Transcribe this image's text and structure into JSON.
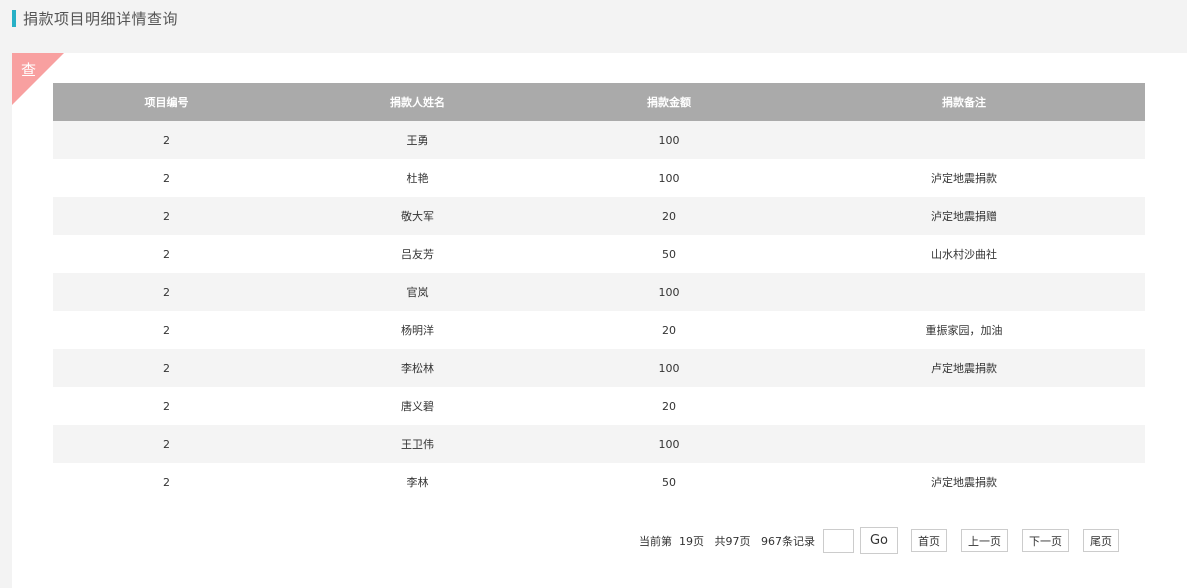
{
  "header": {
    "title": "捐款项目明细详情查询"
  },
  "panel": {
    "corner_label": "查"
  },
  "table": {
    "columns": [
      "项目编号",
      "捐款人姓名",
      "捐款金额",
      "捐款备注"
    ],
    "rows": [
      [
        "2",
        "王勇",
        "100",
        ""
      ],
      [
        "2",
        "杜艳",
        "100",
        "泸定地震捐款"
      ],
      [
        "2",
        "敬大军",
        "20",
        "泸定地震捐赠"
      ],
      [
        "2",
        "吕友芳",
        "50",
        "山水村沙曲社"
      ],
      [
        "2",
        "官岚",
        "100",
        ""
      ],
      [
        "2",
        "杨明洋",
        "20",
        "重振家园，加油"
      ],
      [
        "2",
        "李松林",
        "100",
        "卢定地震捐款"
      ],
      [
        "2",
        "唐义碧",
        "20",
        ""
      ],
      [
        "2",
        "王卫伟",
        "100",
        ""
      ],
      [
        "2",
        "李林",
        "50",
        "泸定地震捐款"
      ]
    ]
  },
  "pager": {
    "current_label": "当前第",
    "current_page": "19页",
    "total_pages": "共97页",
    "total_records": "967条记录",
    "jump_value": "",
    "go_label": "Go",
    "first_label": "首页",
    "prev_label": "上一页",
    "next_label": "下一页",
    "last_label": "尾页"
  }
}
